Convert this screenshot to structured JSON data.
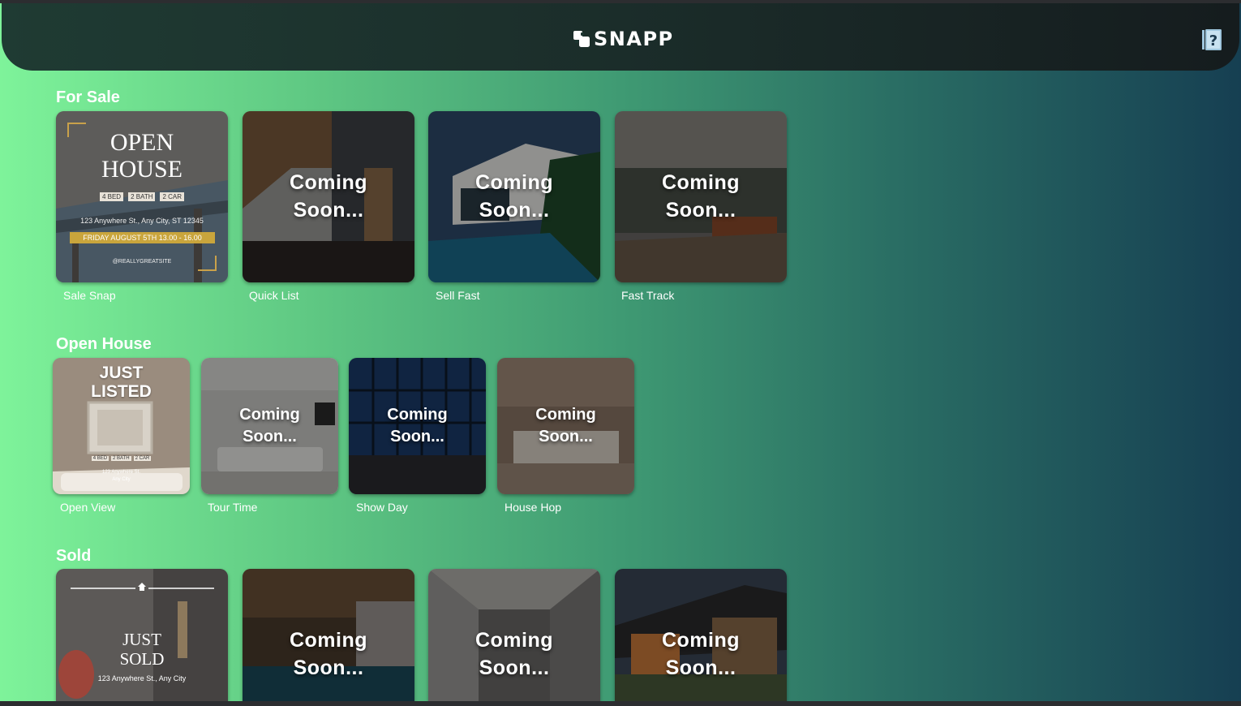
{
  "app": {
    "title": "SNAPP"
  },
  "header": {
    "logo_icon": "snapp-logo-icon",
    "help_icon": "help-book-icon"
  },
  "sections": [
    {
      "title": "For Sale",
      "cards": [
        {
          "label": "Sale Snap",
          "preview": {
            "heading_1": "OPEN",
            "heading_2": "HOUSE",
            "chips": [
              "4 BED",
              "2 BATH",
              "2 CAR"
            ],
            "address": "123 Anywhere St., Any City, ST 12345",
            "date": "FRIDAY AUGUST 5TH   13.00 - 16.00",
            "handle": "@REALLYGREATSITE"
          }
        },
        {
          "label": "Quick List",
          "overlay": "Coming Soon..."
        },
        {
          "label": "Sell Fast",
          "overlay": "Coming Soon..."
        },
        {
          "label": "Fast Track",
          "overlay": "Coming Soon..."
        }
      ]
    },
    {
      "title": "Open House",
      "cards": [
        {
          "label": "Open View",
          "preview": {
            "heading_1": "JUST",
            "heading_2": "LISTED",
            "chips": [
              "4 BED",
              "2 BATH",
              "2 CAR"
            ],
            "address_1": "123 Anywhere St.",
            "address_2": "Any City"
          }
        },
        {
          "label": "Tour Time",
          "overlay": "Coming Soon..."
        },
        {
          "label": "Show Day",
          "overlay": "Coming Soon..."
        },
        {
          "label": "House Hop",
          "overlay": "Coming Soon..."
        }
      ]
    },
    {
      "title": "Sold",
      "cards": [
        {
          "label": "",
          "preview": {
            "heading_1": "JUST",
            "heading_2": "SOLD",
            "address": "123 Anywhere St., Any City"
          }
        },
        {
          "label": "",
          "overlay": "Coming Soon..."
        },
        {
          "label": "",
          "overlay": "Coming Soon..."
        },
        {
          "label": "",
          "overlay": "Coming Soon..."
        }
      ]
    }
  ]
}
